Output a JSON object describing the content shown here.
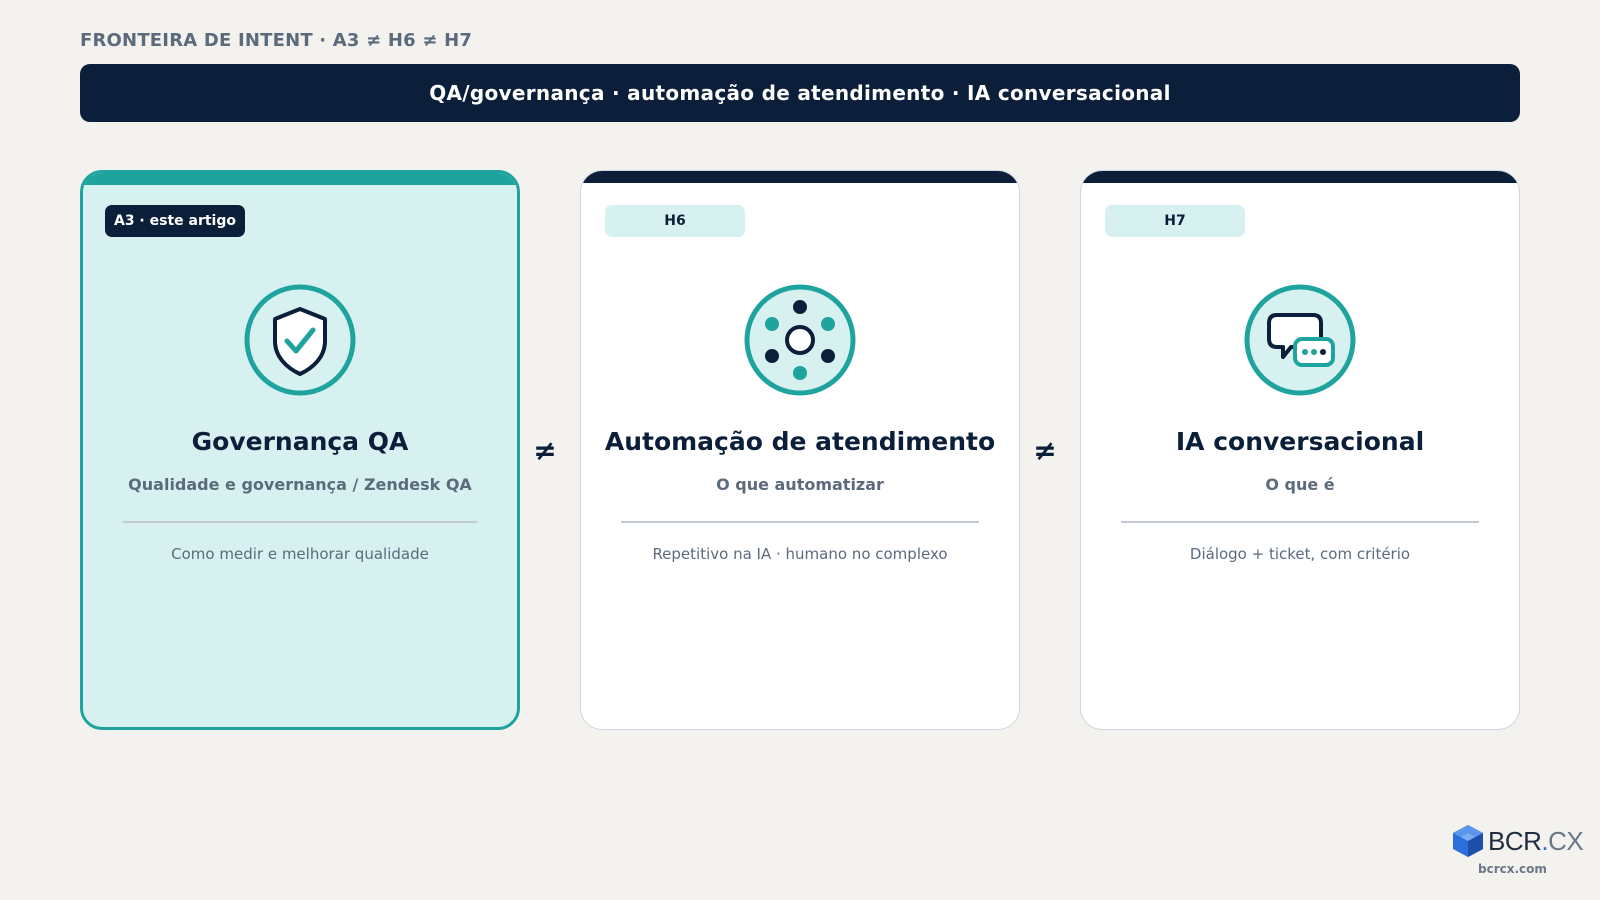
{
  "header": {
    "overline": "FRONTEIRA DE INTENT · A3 ≠ H6 ≠ H7",
    "banner": "QA/governança · automação de atendimento · IA conversacional"
  },
  "cards": [
    {
      "badge": "A3 · este artigo",
      "title": "Governança QA",
      "subtitle": "Qualidade e governança / Zendesk QA",
      "description": "Como medir e melhorar qualidade",
      "icon": "shield-check-icon",
      "active": true
    },
    {
      "badge": "H6",
      "title": "Automação de atendimento",
      "subtitle": "O que automatizar",
      "description": "Repetitivo na IA · humano no complexo",
      "icon": "automation-nodes-icon",
      "active": false
    },
    {
      "badge": "H7",
      "title": "IA conversacional",
      "subtitle": "O que é",
      "description": "Diálogo + ticket, com critério",
      "icon": "chat-bubbles-icon",
      "active": false
    }
  ],
  "separators": [
    "≠",
    "≠"
  ],
  "logo": {
    "brand_a": "BCR",
    "brand_dot": ".",
    "brand_b": "CX",
    "url": "bcrcx.com"
  },
  "colors": {
    "navy": "#0b1f3a",
    "teal": "#1fa39e",
    "teal_light": "#d7f0f0",
    "muted": "#5b6b7c",
    "background": "#f3f2ef"
  }
}
